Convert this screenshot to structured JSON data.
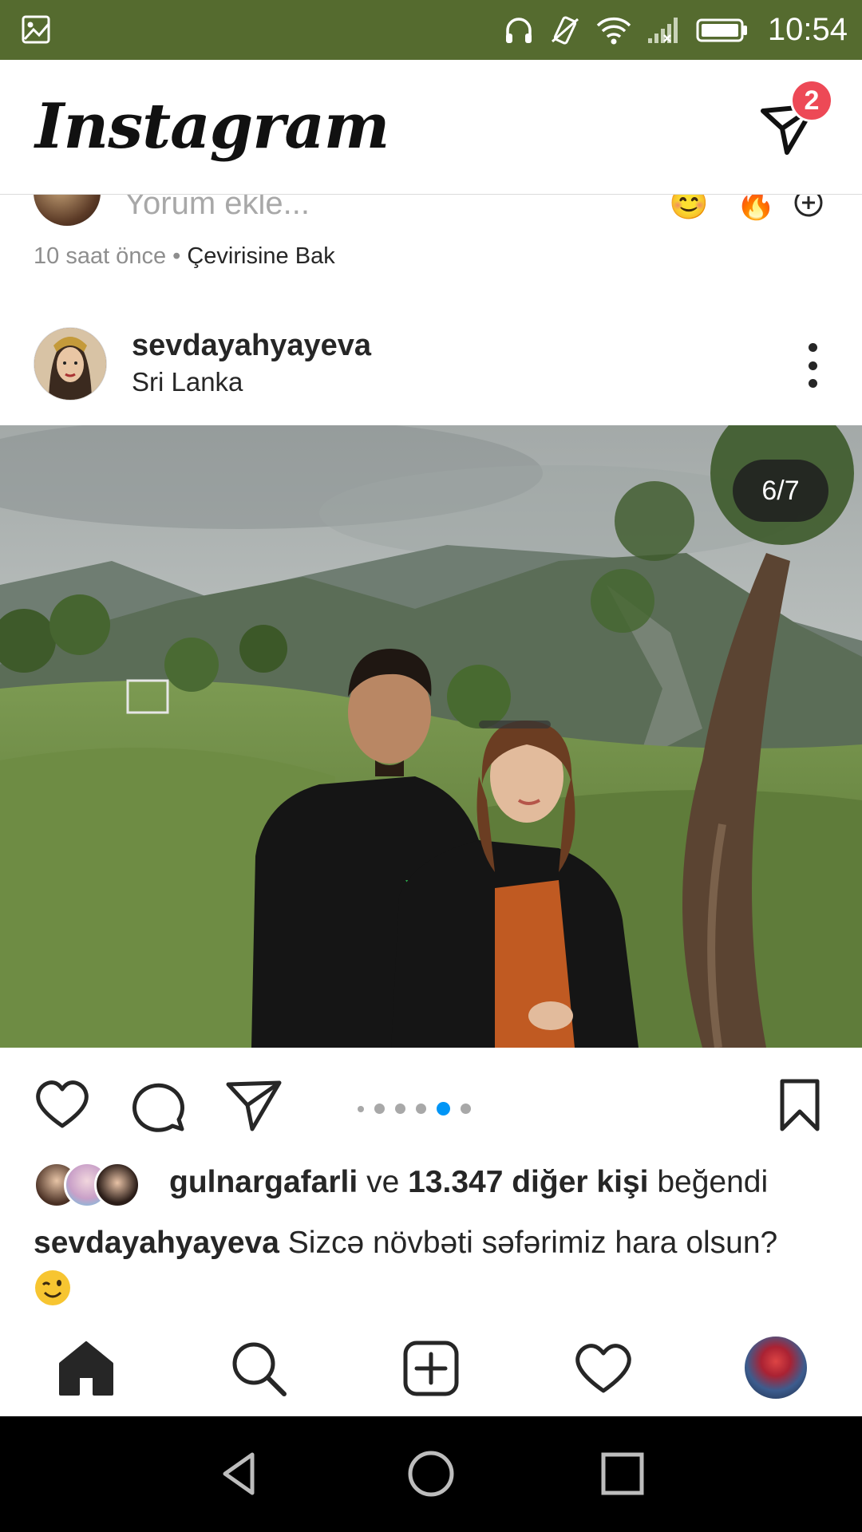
{
  "status_bar": {
    "time": "10:54",
    "icons": [
      "image-icon",
      "headphones-icon",
      "vibrate-icon",
      "wifi-icon",
      "signal-icon",
      "battery-icon"
    ],
    "background": "#556b2f"
  },
  "header": {
    "brand": "Instagram",
    "dm_badge": "2"
  },
  "previous_post": {
    "comment_placeholder": "Yorum ekle...",
    "quick_emojis": [
      "😊",
      "🔥"
    ],
    "time_ago": "10 saat önce",
    "separator": "•",
    "see_translation": "Çevirisine Bak"
  },
  "post": {
    "username": "sevdayahyayeva",
    "location": "Sri Lanka",
    "carousel_counter": "6/7",
    "carousel_total": 7,
    "carousel_current": 6,
    "likes": {
      "first_user": "gulnargafarli",
      "connector": "ve",
      "others": "13.347 diğer kişi",
      "suffix": "beğendi"
    },
    "caption": {
      "username": "sevdayahyayeva",
      "text": "Sizcə növbəti səfərimiz hara olsun?",
      "emoji": "😉"
    }
  },
  "bottom_nav": {
    "items": [
      "home-icon",
      "search-icon",
      "new-post-icon",
      "activity-heart-icon",
      "profile-avatar"
    ]
  },
  "colors": {
    "accent_blue": "#0095f6",
    "badge_red": "#ed4956"
  }
}
